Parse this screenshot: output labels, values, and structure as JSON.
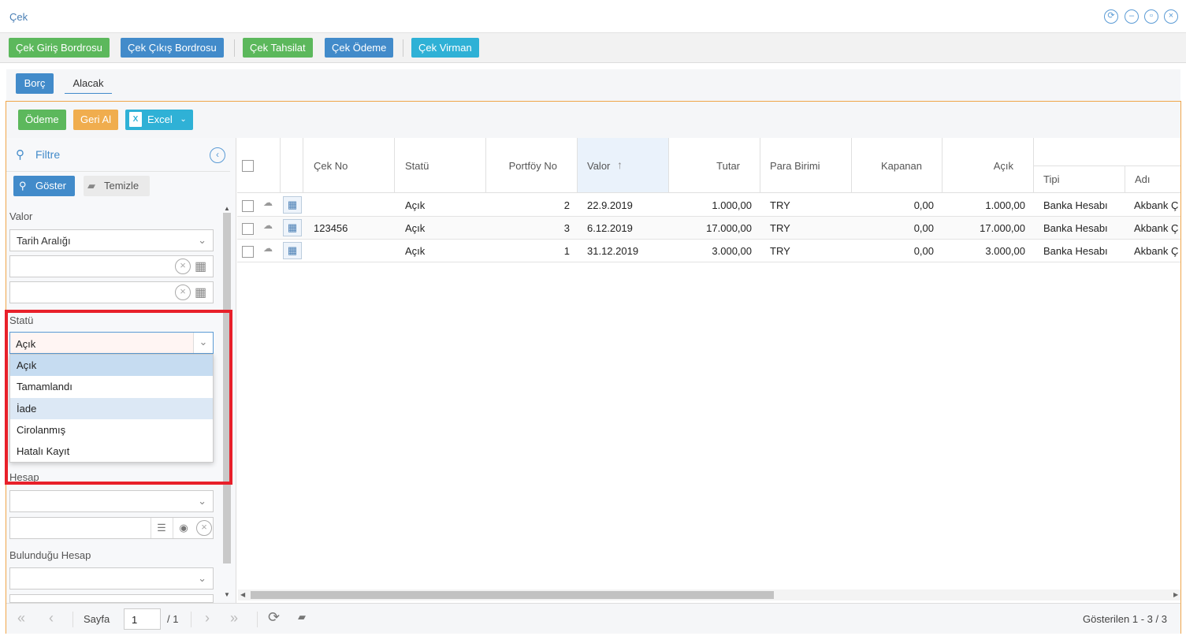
{
  "window": {
    "title": "Çek"
  },
  "toolbar": {
    "items": [
      {
        "label": "Çek Giriş Bordrosu"
      },
      {
        "label": "Çek Çıkış Bordrosu"
      },
      {
        "label": "Çek Tahsilat"
      },
      {
        "label": "Çek Ödeme"
      },
      {
        "label": "Çek Virman"
      }
    ]
  },
  "tabs": {
    "borc": "Borç",
    "alacak": "Alacak"
  },
  "actions": {
    "odeme": "Ödeme",
    "geri_al": "Geri Al",
    "excel": "Excel"
  },
  "filter": {
    "title": "Filtre",
    "show": "Göster",
    "clear": "Temizle",
    "valor_label": "Valor",
    "valor_value": "Tarih Aralığı",
    "statu_label": "Statü",
    "statu_value": "Açık",
    "hesap_label": "Hesap",
    "bulundugu_label": "Bulunduğu Hesap",
    "statu_options": [
      "Açık",
      "Tamamlandı",
      "İade",
      "Cirolanmış",
      "Hatalı Kayıt"
    ]
  },
  "grid": {
    "headers": {
      "cek_no": "Çek No",
      "statu": "Statü",
      "portfoy": "Portföy No",
      "valor": "Valor",
      "tutar": "Tutar",
      "para": "Para Birimi",
      "kapanan": "Kapanan",
      "acik": "Açık",
      "tipi": "Tipi",
      "adi": "Adı"
    },
    "rows": [
      {
        "cek_no": "",
        "statu": "Açık",
        "portfoy": "2",
        "valor": "22.9.2019",
        "tutar": "1.000,00",
        "para": "TRY",
        "kapanan": "0,00",
        "acik": "1.000,00",
        "tipi": "Banka Hesabı",
        "adi": "Akbank Ç"
      },
      {
        "cek_no": "123456",
        "statu": "Açık",
        "portfoy": "3",
        "valor": "6.12.2019",
        "tutar": "17.000,00",
        "para": "TRY",
        "kapanan": "0,00",
        "acik": "17.000,00",
        "tipi": "Banka Hesabı",
        "adi": "Akbank Ç"
      },
      {
        "cek_no": "",
        "statu": "Açık",
        "portfoy": "1",
        "valor": "31.12.2019",
        "tutar": "3.000,00",
        "para": "TRY",
        "kapanan": "0,00",
        "acik": "3.000,00",
        "tipi": "Banka Hesabı",
        "adi": "Akbank Ç"
      }
    ]
  },
  "footer": {
    "page_label": "Sayfa",
    "page_value": "1",
    "page_total": "/ 1",
    "shown": "Gösterilen 1 - 3 / 3"
  },
  "colors": {
    "highlight": "#e8202a",
    "accent": "#428bca"
  }
}
